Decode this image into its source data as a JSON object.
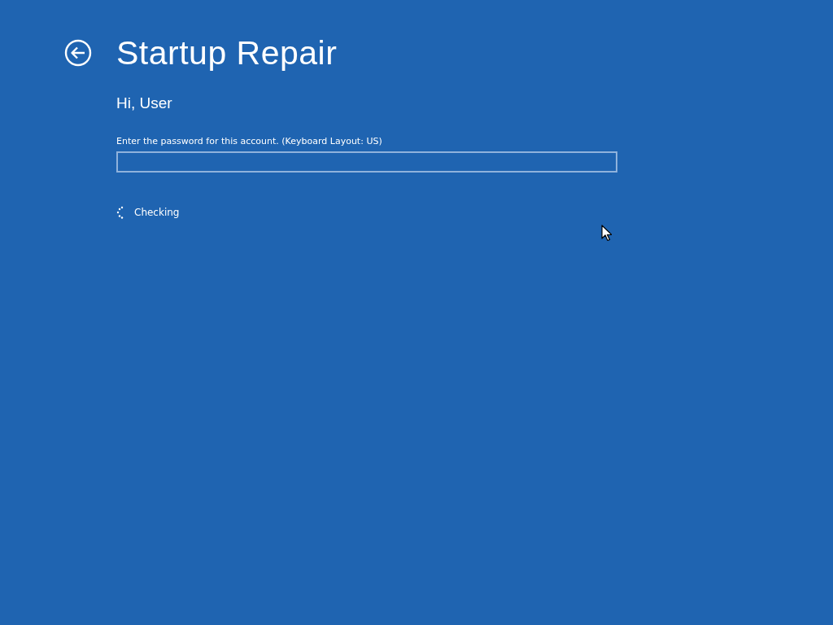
{
  "header": {
    "title": "Startup Repair"
  },
  "greeting": "Hi, User",
  "password": {
    "label": "Enter the password for this account. (Keyboard Layout: US)"
  },
  "status": {
    "text": "Checking"
  }
}
